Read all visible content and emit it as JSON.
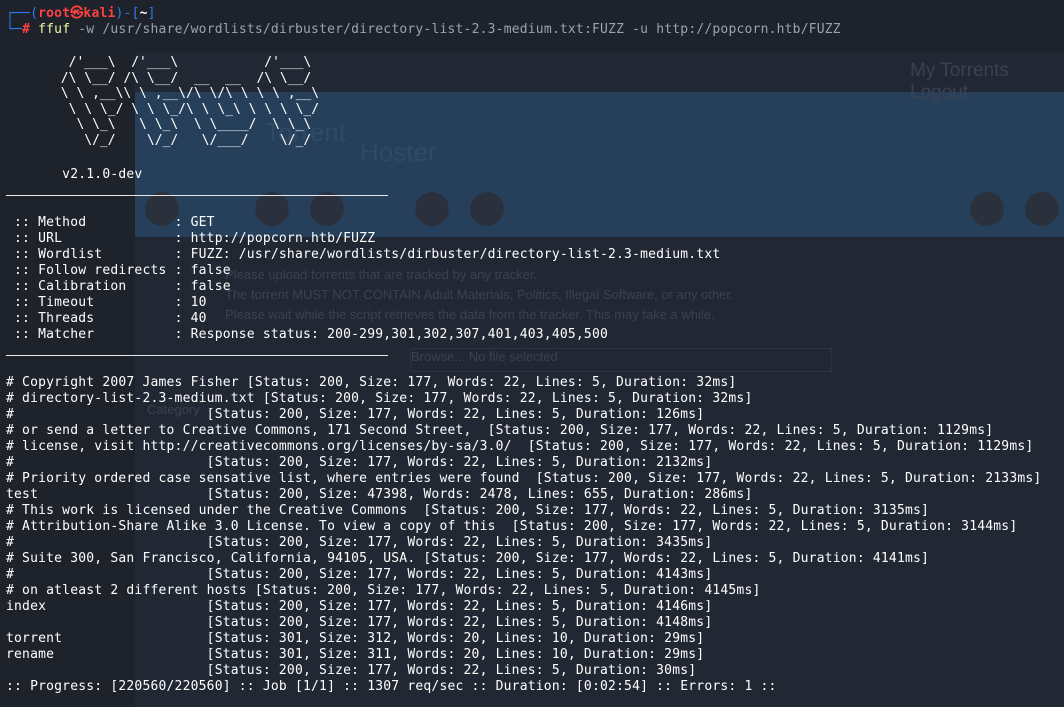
{
  "background_window": {
    "header_links": "My Torrents   Logout",
    "logo_word1": "Torrent",
    "logo_word2": "Hoster",
    "notice1": "Please upload torrents that are tracked by any tracker.",
    "notice2": "The torrent MUST NOT CONTAIN Adult Materials, Politics, Illegal Software, or any other.",
    "notice3": "Please wait while the script retrieves the data from the tracker. This may take a while.",
    "browse_label": "Browse...  No file selected",
    "category_label": "Category"
  },
  "prompt": {
    "open_bracket": "┌──(",
    "user": "root㉿kali",
    "mid": ")-[",
    "cwd": "~",
    "close_bracket": "]",
    "arrow": "└─",
    "hash": "#",
    "command": "ffuf",
    "flag_w": "-w",
    "wordlist_arg": "/usr/share/wordlists/dirbuster/directory-list-2.3-medium.txt:FUZZ",
    "flag_u": "-u",
    "url_arg": "http://popcorn.htb/FUZZ"
  },
  "banner": {
    "ascii": "        /'___\\  /'___\\           /'___\\\n       /\\ \\__/ /\\ \\__/  __  __  /\\ \\__/\n       \\ \\ ,__\\\\ \\ ,__\\/\\ \\/\\ \\ \\ \\ ,__\\\n        \\ \\ \\_/ \\ \\ \\_/\\ \\ \\_\\ \\ \\ \\ \\_/\n         \\ \\_\\   \\ \\_\\  \\ \\____/  \\ \\_\\\n          \\/_/    \\/_/   \\/___/    \\/_/",
    "version": "       v2.1.0-dev"
  },
  "config": [
    {
      "key": " :: Method           ",
      "value": ": GET"
    },
    {
      "key": " :: URL              ",
      "value": ": http://popcorn.htb/FUZZ"
    },
    {
      "key": " :: Wordlist         ",
      "value": ": FUZZ: /usr/share/wordlists/dirbuster/directory-list-2.3-medium.txt"
    },
    {
      "key": " :: Follow redirects ",
      "value": ": false"
    },
    {
      "key": " :: Calibration      ",
      "value": ": false"
    },
    {
      "key": " :: Timeout          ",
      "value": ": 10"
    },
    {
      "key": " :: Threads          ",
      "value": ": 40"
    },
    {
      "key": " :: Matcher          ",
      "value": ": Response status: 200-299,301,302,307,401,403,405,500"
    }
  ],
  "results": [
    "# Copyright 2007 James Fisher [Status: 200, Size: 177, Words: 22, Lines: 5, Duration: 32ms]",
    "# directory-list-2.3-medium.txt [Status: 200, Size: 177, Words: 22, Lines: 5, Duration: 32ms]",
    "#                        [Status: 200, Size: 177, Words: 22, Lines: 5, Duration: 126ms]",
    "# or send a letter to Creative Commons, 171 Second Street,  [Status: 200, Size: 177, Words: 22, Lines: 5, Duration: 1129ms]",
    "# license, visit http://creativecommons.org/licenses/by-sa/3.0/  [Status: 200, Size: 177, Words: 22, Lines: 5, Duration: 1129ms]",
    "#                        [Status: 200, Size: 177, Words: 22, Lines: 5, Duration: 2132ms]",
    "# Priority ordered case sensative list, where entries were found  [Status: 200, Size: 177, Words: 22, Lines: 5, Duration: 2133ms]",
    "test                     [Status: 200, Size: 47398, Words: 2478, Lines: 655, Duration: 286ms]",
    "# This work is licensed under the Creative Commons  [Status: 200, Size: 177, Words: 22, Lines: 5, Duration: 3135ms]",
    "# Attribution-Share Alike 3.0 License. To view a copy of this  [Status: 200, Size: 177, Words: 22, Lines: 5, Duration: 3144ms]",
    "#                        [Status: 200, Size: 177, Words: 22, Lines: 5, Duration: 3435ms]",
    "# Suite 300, San Francisco, California, 94105, USA. [Status: 200, Size: 177, Words: 22, Lines: 5, Duration: 4141ms]",
    "#                        [Status: 200, Size: 177, Words: 22, Lines: 5, Duration: 4143ms]",
    "# on atleast 2 different hosts [Status: 200, Size: 177, Words: 22, Lines: 5, Duration: 4145ms]",
    "index                    [Status: 200, Size: 177, Words: 22, Lines: 5, Duration: 4146ms]",
    "                         [Status: 200, Size: 177, Words: 22, Lines: 5, Duration: 4148ms]",
    "torrent                  [Status: 301, Size: 312, Words: 20, Lines: 10, Duration: 29ms]",
    "rename                   [Status: 301, Size: 311, Words: 20, Lines: 10, Duration: 29ms]",
    "                         [Status: 200, Size: 177, Words: 22, Lines: 5, Duration: 30ms]"
  ],
  "progress": ":: Progress: [220560/220560] :: Job [1/1] :: 1307 req/sec :: Duration: [0:02:54] :: Errors: 1 ::",
  "colors": {
    "background": "#1d222b",
    "prompt_blue": "#2f7bf5",
    "prompt_red": "#ff4141",
    "command_yellow": "#f3f99d",
    "text": "#ffffff"
  }
}
